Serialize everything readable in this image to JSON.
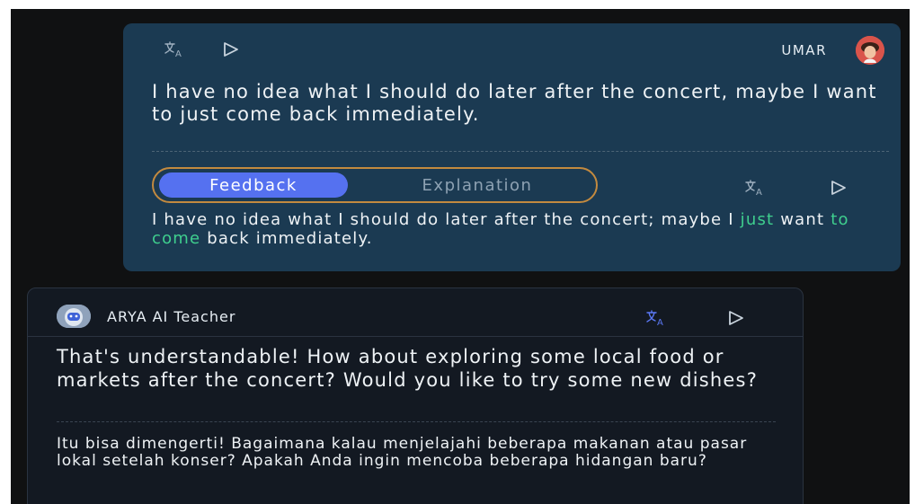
{
  "user_message": {
    "name": "UMAR",
    "text": "I have no idea what I should do later after the concert, maybe I want to just come back immediately.",
    "icons": {
      "translate": "translate-icon",
      "play": "play-icon",
      "avatar": "user-avatar"
    }
  },
  "feedback": {
    "tabs": {
      "active": "Feedback",
      "inactive": "Explanation"
    },
    "corrected": {
      "part1": "I have no idea what I should do later after the concert; maybe I ",
      "hl1": "just",
      "part2": " want ",
      "hl2": "to come",
      "part3": " back immediately."
    },
    "highlight_color": "#3fcf8e",
    "icons": {
      "translate": "translate-icon",
      "play": "play-icon"
    }
  },
  "ai_message": {
    "name": "ARYA AI Teacher",
    "text": "That's understandable! How about exploring some local food or markets after the concert? Would you like to try some new dishes?",
    "translation": "Itu bisa dimengerti! Bagaimana kalau menjelajahi beberapa makanan atau pasar lokal setelah konser? Apakah Anda ingin mencoba beberapa hidangan baru?",
    "icons": {
      "translate": "translate-icon-active",
      "play": "play-icon",
      "avatar": "robot-avatar"
    }
  },
  "colors": {
    "background": "#101112",
    "user_bubble": "#1b3a52",
    "ai_bubble": "#131922",
    "accent": "#5571f0",
    "tab_border": "#c38a3f"
  }
}
